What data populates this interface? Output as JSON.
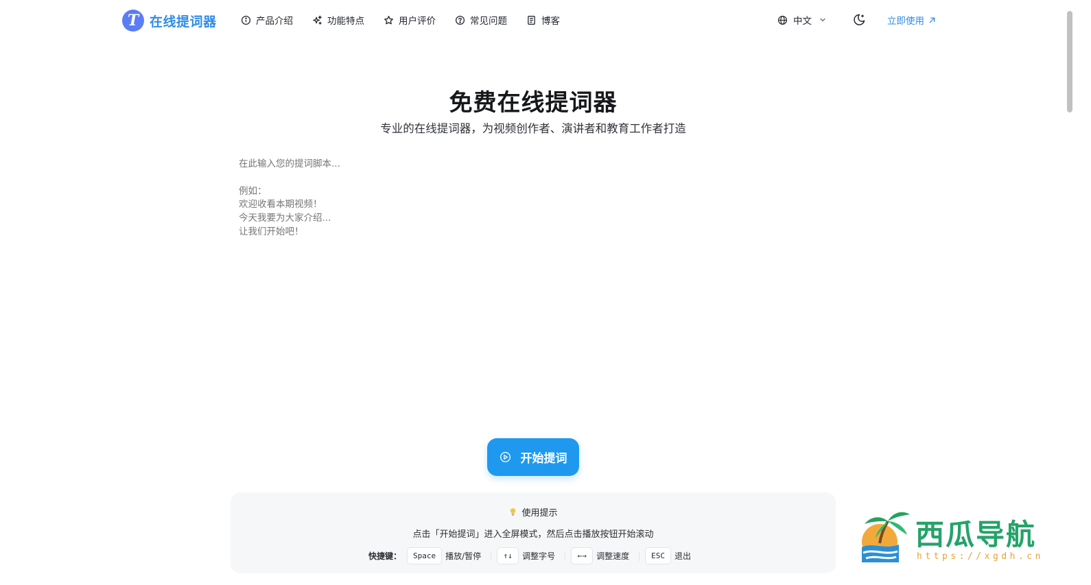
{
  "header": {
    "logo_letter": "T",
    "logo_text": "在线提词器",
    "nav": [
      {
        "label": "产品介绍",
        "icon": "info-icon"
      },
      {
        "label": "功能特点",
        "icon": "sparkles-icon"
      },
      {
        "label": "用户评价",
        "icon": "star-icon"
      },
      {
        "label": "常见问题",
        "icon": "help-circle-icon"
      },
      {
        "label": "博客",
        "icon": "document-icon"
      }
    ],
    "language": "中文",
    "cta_label": "立即使用"
  },
  "hero": {
    "title": "免费在线提词器",
    "subtitle": "专业的在线提词器，为视频创作者、演讲者和教育工作者打造"
  },
  "script": {
    "placeholder": "在此输入您的提词脚本...\n\n例如：\n欢迎收看本期视频！\n今天我要为大家介绍...\n让我们开始吧！"
  },
  "start_button": {
    "label": "开始提词"
  },
  "tips": {
    "title": "使用提示",
    "description": "点击「开始提词」进入全屏模式，然后点击播放按钮开始滚动",
    "shortcuts_label": "快捷键：",
    "shortcuts": [
      {
        "key": "Space",
        "desc": "播放/暂停"
      },
      {
        "key": "↑↓",
        "desc": "调整字号"
      },
      {
        "key": "←→",
        "desc": "调整速度"
      },
      {
        "key": "ESC",
        "desc": "退出"
      }
    ]
  },
  "watermark": {
    "text": "西瓜导航",
    "url": "https://xgdh.cn"
  },
  "colors": {
    "brand": "#2f8ce8",
    "logo_badge": "#5b7df5",
    "start_button": "#1f99ef",
    "tips_bg": "#f6f7f8"
  }
}
